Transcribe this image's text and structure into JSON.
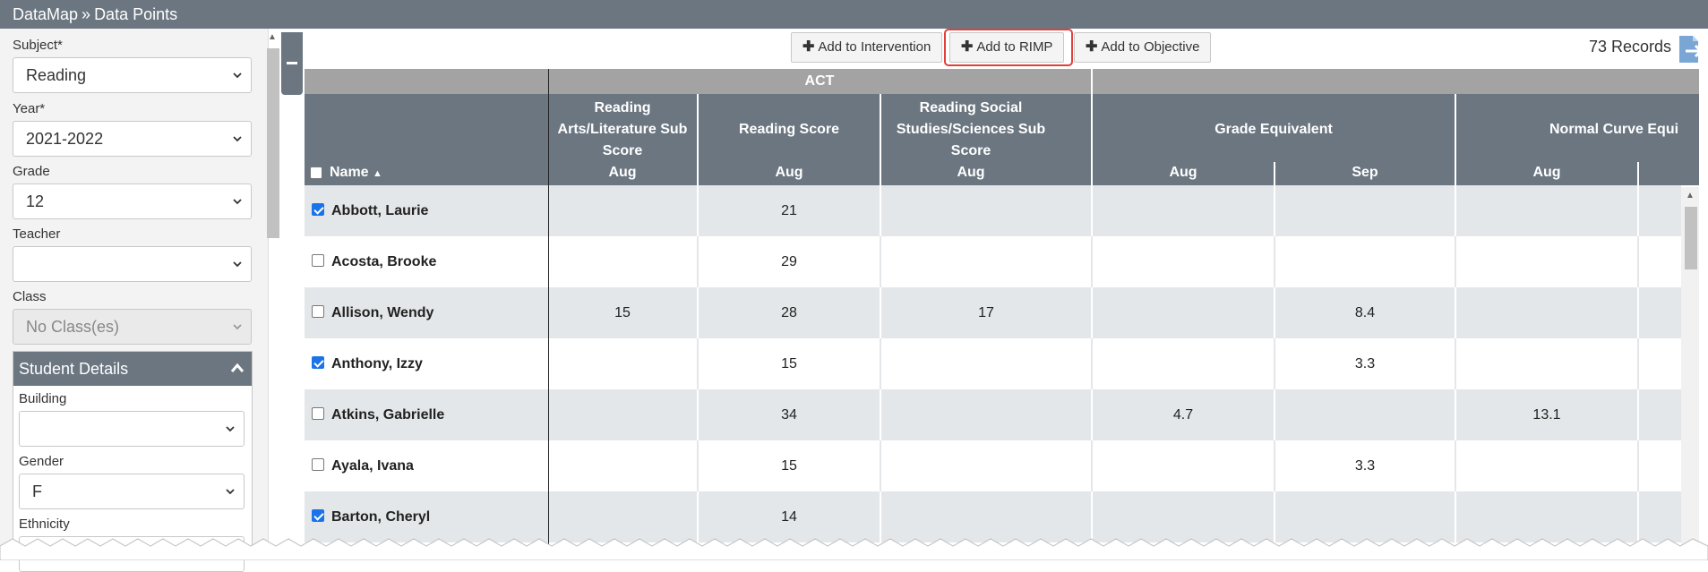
{
  "titlebar": {
    "app": "DataMap",
    "separator": "»",
    "page": "Data Points"
  },
  "filters": {
    "subject": {
      "label": "Subject*",
      "value": "Reading"
    },
    "year": {
      "label": "Year*",
      "value": "2021-2022"
    },
    "grade": {
      "label": "Grade",
      "value": "12"
    },
    "teacher": {
      "label": "Teacher",
      "value": ""
    },
    "class": {
      "label": "Class",
      "value": "No Class(es)"
    }
  },
  "student_details": {
    "title": "Student Details",
    "building": {
      "label": "Building",
      "value": ""
    },
    "gender": {
      "label": "Gender",
      "value": "F"
    },
    "ethnicity": {
      "label": "Ethnicity"
    }
  },
  "toolbar": {
    "add_intervention": "Add to Intervention",
    "add_rimp": "Add to RIMP",
    "add_objective": "Add to Objective",
    "records": "73 Records"
  },
  "grid": {
    "group_header": "ACT",
    "name_header": "Name",
    "columns": [
      {
        "title": "Reading Arts/Literature Sub Score",
        "month": "Aug"
      },
      {
        "title": "Reading Score",
        "month": "Aug"
      },
      {
        "title": "Reading Social Studies/Sciences Sub Score",
        "month": "Aug"
      },
      {
        "title": "Grade Equivalent",
        "month_a": "Aug",
        "month_b": "Sep"
      },
      {
        "title": "Normal Curve Equi",
        "month": "Aug"
      }
    ],
    "rows": [
      {
        "name": "Abbott, Laurie",
        "checked": true,
        "lit": "",
        "score": "21",
        "soc": "",
        "ge_aug": "",
        "ge_sep": "",
        "nce": ""
      },
      {
        "name": "Acosta, Brooke",
        "checked": false,
        "lit": "",
        "score": "29",
        "soc": "",
        "ge_aug": "",
        "ge_sep": "",
        "nce": ""
      },
      {
        "name": "Allison, Wendy",
        "checked": false,
        "lit": "15",
        "score": "28",
        "soc": "17",
        "ge_aug": "",
        "ge_sep": "8.4",
        "nce": ""
      },
      {
        "name": "Anthony, Izzy",
        "checked": true,
        "lit": "",
        "score": "15",
        "soc": "",
        "ge_aug": "",
        "ge_sep": "3.3",
        "nce": ""
      },
      {
        "name": "Atkins, Gabrielle",
        "checked": false,
        "lit": "",
        "score": "34",
        "soc": "",
        "ge_aug": "4.7",
        "ge_sep": "",
        "nce": "13.1"
      },
      {
        "name": "Ayala, Ivana",
        "checked": false,
        "lit": "",
        "score": "15",
        "soc": "",
        "ge_aug": "",
        "ge_sep": "3.3",
        "nce": ""
      },
      {
        "name": "Barton, Cheryl",
        "checked": true,
        "lit": "",
        "score": "14",
        "soc": "",
        "ge_aug": "",
        "ge_sep": "",
        "nce": ""
      }
    ]
  },
  "colors": {
    "header_bg": "#6b7681",
    "group_bg": "#a3a3a3",
    "highlight": "#e0403a",
    "row_alt": "#e4e7e9"
  }
}
